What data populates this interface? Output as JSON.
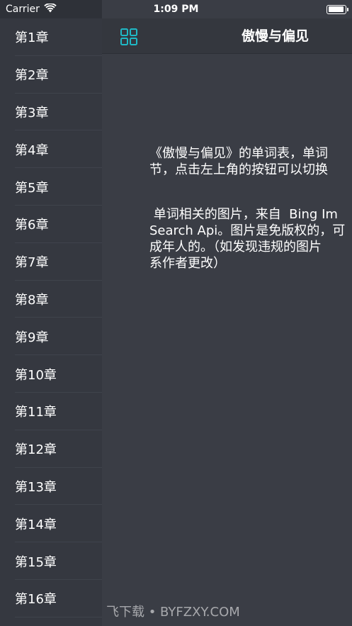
{
  "status_bar": {
    "carrier": "Carrier",
    "time": "1:09 PM"
  },
  "sidebar": {
    "chapters": [
      "第1章",
      "第2章",
      "第3章",
      "第4章",
      "第5章",
      "第6章",
      "第7章",
      "第8章",
      "第9章",
      "第10章",
      "第11章",
      "第12章",
      "第13章",
      "第14章",
      "第15章",
      "第16章"
    ]
  },
  "nav": {
    "title": "傲慢与偏见",
    "menu_icon": "grid-icon",
    "accent_color": "#1fb9c6"
  },
  "content": {
    "para1_line1": "《傲慢与偏见》的单词表，单词",
    "para1_line2": "节，点击左上角的按钮可以切换",
    "para2_line1": " 单词相关的图片，来自  Bing Im",
    "para2_line2": "Search Api。图片是免版权的，可",
    "para2_line3": "成年人的。（如发现违规的图片",
    "para2_line4": "系作者更改）"
  },
  "watermark": "飞下载 • BYFZXY.COM"
}
